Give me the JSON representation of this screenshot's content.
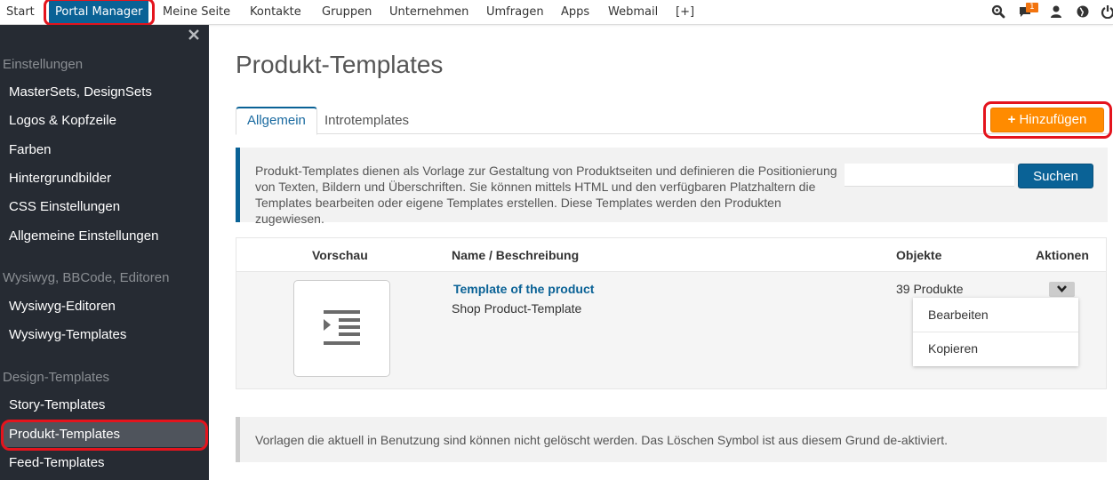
{
  "topnav": {
    "items": [
      {
        "label": "Start"
      },
      {
        "label": "Portal Manager",
        "active": true
      },
      {
        "label": "Meine Seite"
      },
      {
        "label": "Kontakte"
      },
      {
        "label": "Gruppen"
      },
      {
        "label": "Unternehmen"
      },
      {
        "label": "Umfragen"
      },
      {
        "label": "Apps"
      },
      {
        "label": "Webmail"
      },
      {
        "label": "[+]"
      }
    ],
    "icons": [
      "search-icon",
      "messages-icon",
      "user-icon",
      "globe-icon",
      "power-icon"
    ],
    "messages_badge": "1"
  },
  "sidebar": {
    "sections": [
      {
        "title": "Einstellungen",
        "items": [
          "MasterSets, DesignSets",
          "Logos & Kopfzeile",
          "Farben",
          "Hintergrundbilder",
          "CSS Einstellungen",
          "Allgemeine Einstellungen"
        ]
      },
      {
        "title": "Wysiwyg, BBCode, Editoren",
        "items": [
          "Wysiwyg-Editoren",
          "Wysiwyg-Templates"
        ]
      },
      {
        "title": "Design-Templates",
        "items": [
          "Story-Templates",
          "Produkt-Templates",
          "Feed-Templates"
        ]
      }
    ],
    "active_item": "Produkt-Templates"
  },
  "main": {
    "title": "Produkt-Templates",
    "tabs": [
      {
        "label": "Allgemein",
        "active": true
      },
      {
        "label": "Introtemplates"
      }
    ],
    "add_button": "Hinzufügen",
    "info_text": "Produkt-Templates dienen als Vorlage zur Gestaltung von Produktseiten und definieren die Positionierung von Texten, Bildern und Überschriften. Sie können mittels HTML und den verfügbaren Platzhaltern die Templates bearbeiten oder eigene Templates erstellen. Diese Templates werden den Produkten zugewiesen.",
    "search": {
      "value": "",
      "placeholder": "",
      "button": "Suchen"
    },
    "table": {
      "columns": [
        "Vorschau",
        "Name / Beschreibung",
        "Objekte",
        "Aktionen"
      ],
      "rows": [
        {
          "name": "Template of the product",
          "description": "Shop Product-Template",
          "objects": "39 Produkte"
        }
      ]
    },
    "action_menu": [
      "Bearbeiten",
      "Kopieren"
    ],
    "note": "Vorlagen die aktuell in Benutzung sind können nicht gelöscht werden. Das Löschen Symbol ist aus diesem Grund de-aktiviert."
  },
  "colors": {
    "primary": "#0a6296",
    "accent": "#ff8b00",
    "sidebar_bg": "#262b33",
    "highlight": "#e4141d"
  }
}
